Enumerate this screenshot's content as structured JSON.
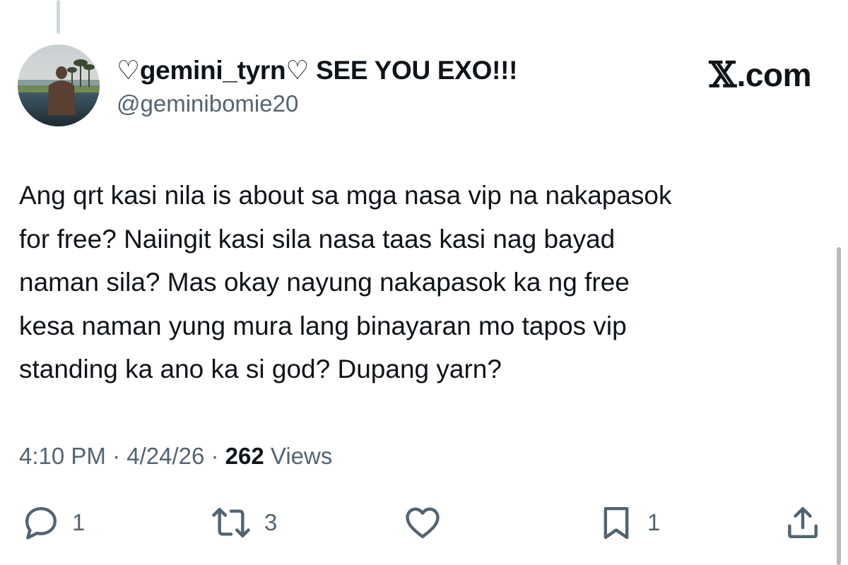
{
  "author": {
    "display_name": "♡gemini_tyrn♡ SEE YOU EXO!!!",
    "handle": "@geminibomie20"
  },
  "brand": {
    "x_mark": "𝕏",
    "domain": ".com"
  },
  "tweet": {
    "lines": [
      "Ang qrt kasi nila is about sa mga nasa vip na nakapasok",
      "for free?  Naiingit kasi sila nasa taas kasi nag bayad",
      "naman sila?  Mas okay nayung nakapasok ka ng free",
      "kesa naman yung mura lang binayaran mo tapos vip",
      "standing ka ano ka si god?  Dupang yarn?"
    ]
  },
  "meta": {
    "time": "4:10 PM",
    "separator": " · ",
    "date": "4/24/26",
    "views_count": "262",
    "views_label": " Views"
  },
  "actions": {
    "reply": {
      "icon": "reply-icon",
      "count": "1"
    },
    "retweet": {
      "icon": "retweet-icon",
      "count": "3"
    },
    "like": {
      "icon": "heart-icon",
      "count": ""
    },
    "bookmark": {
      "icon": "bookmark-icon",
      "count": "1"
    },
    "share": {
      "icon": "share-icon",
      "count": ""
    }
  },
  "colors": {
    "text": "#0f1419",
    "secondary": "#536471",
    "thread_line": "#cfd9de"
  }
}
